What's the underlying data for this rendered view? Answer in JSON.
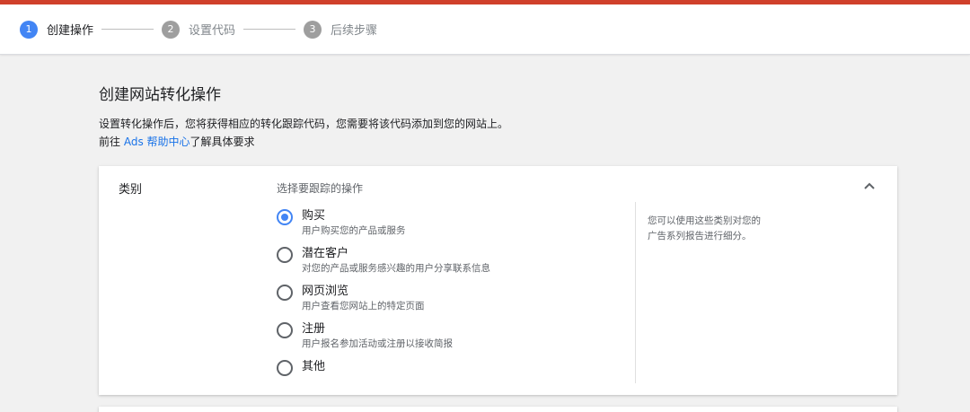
{
  "stepper": {
    "steps": [
      {
        "number": "1",
        "label": "创建操作"
      },
      {
        "number": "2",
        "label": "设置代码"
      },
      {
        "number": "3",
        "label": "后续步骤"
      }
    ]
  },
  "page": {
    "title": "创建网站转化操作",
    "desc_line1": "设置转化操作后，您将获得相应的转化跟踪代码，您需要将该代码添加到您的网站上。",
    "desc_prefix": "前往 ",
    "desc_link": "Ads 帮助中心",
    "desc_suffix": "了解具体要求"
  },
  "category": {
    "label": "类别",
    "section_title": "选择要跟踪的操作",
    "options": [
      {
        "label": "购买",
        "sub": "用户购买您的产品或服务",
        "checked": true
      },
      {
        "label": "潜在客户",
        "sub": "对您的产品或服务感兴趣的用户分享联系信息",
        "checked": false
      },
      {
        "label": "网页浏览",
        "sub": "用户查看您网站上的特定页面",
        "checked": false
      },
      {
        "label": "注册",
        "sub": "用户报名参加活动或注册以接收简报",
        "checked": false
      },
      {
        "label": "其他",
        "sub": "",
        "checked": false
      }
    ],
    "help_line1": "您可以使用这些类别对您的",
    "help_line2": "广告系列报告进行细分。"
  },
  "colors": {
    "accent": "#4285f4",
    "top_bar": "#d0402b",
    "link": "#1a73e8"
  }
}
